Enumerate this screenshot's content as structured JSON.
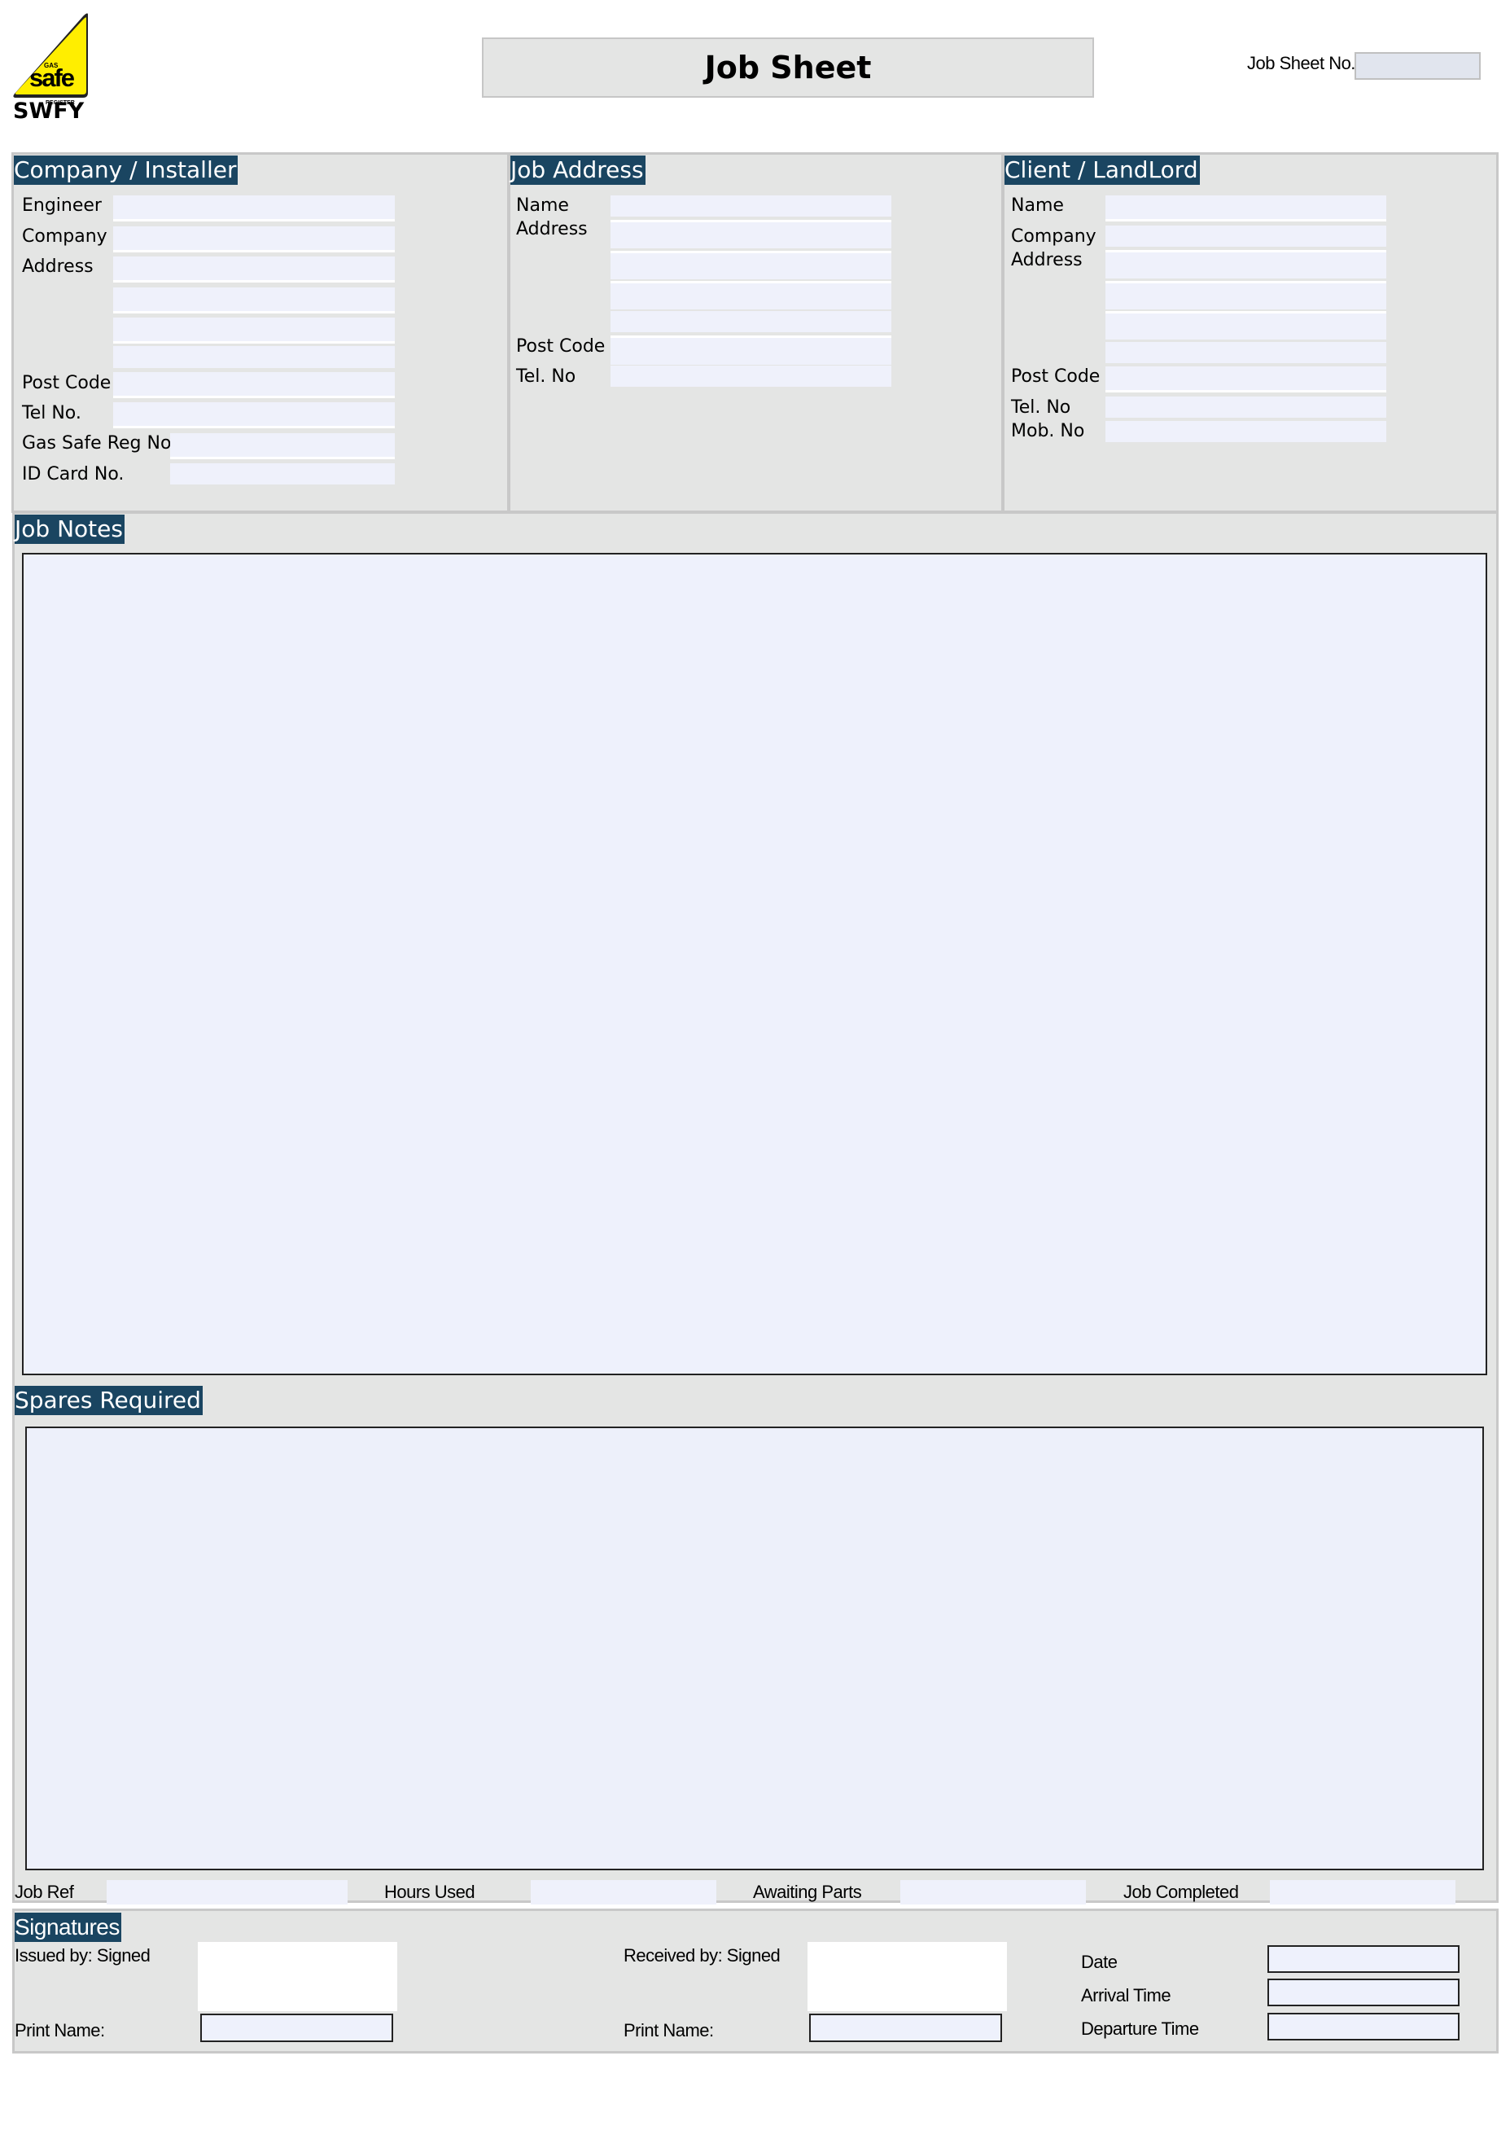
{
  "logo": {
    "brand_top": "GAS",
    "brand_main": "safe",
    "brand_bottom": "REGISTER",
    "company_code": "SWFY",
    "icon": "gas-safe-triangle-icon",
    "color": "#ffee00"
  },
  "header": {
    "title": "Job Sheet",
    "job_sheet_no_label": "Job Sheet No.",
    "job_sheet_no_value": ""
  },
  "colors": {
    "heading_bg": "#1a4561",
    "panel_bg": "#e4e5e4",
    "field_bg": "#eff1fb"
  },
  "company_installer": {
    "heading": "Company / Installer",
    "labels": {
      "engineer": "Engineer",
      "company": "Company",
      "address": "Address",
      "post_code": "Post Code",
      "tel_no": "Tel No.",
      "gas_safe_reg_no": "Gas Safe Reg No.",
      "id_card_no": "ID Card No."
    },
    "values": {
      "engineer": "",
      "company": "",
      "address_1": "",
      "address_2": "",
      "address_3": "",
      "address_4": "",
      "post_code": "",
      "tel_no": "",
      "gas_safe_reg_no": "",
      "id_card_no": ""
    }
  },
  "job_address": {
    "heading": "Job Address",
    "labels": {
      "name": "Name",
      "address": "Address",
      "post_code": "Post Code",
      "tel_no": "Tel. No"
    },
    "values": {
      "name": "",
      "address_1": "",
      "address_2": "",
      "address_3": "",
      "address_4": "",
      "post_code": "",
      "tel_no": ""
    }
  },
  "client_landlord": {
    "heading": "Client / LandLord",
    "labels": {
      "name": "Name",
      "company": "Company",
      "address": "Address",
      "post_code": "Post Code",
      "tel_no": "Tel. No",
      "mob_no": "Mob. No"
    },
    "values": {
      "name": "",
      "company": "",
      "address_1": "",
      "address_2": "",
      "address_3": "",
      "address_4": "",
      "post_code": "",
      "tel_no": "",
      "mob_no": ""
    }
  },
  "job_notes": {
    "heading": "Job Notes",
    "value": ""
  },
  "spares_required": {
    "heading": "Spares Required",
    "value": ""
  },
  "status_row": {
    "job_ref_label": "Job Ref",
    "hours_used_label": "Hours Used",
    "awaiting_parts_label": "Awaiting Parts",
    "job_completed_label": "Job Completed",
    "job_ref": "",
    "hours_used": "",
    "awaiting_parts": "",
    "job_completed": ""
  },
  "signatures": {
    "heading": "Signatures",
    "issued_by_label": "Issued by: Signed",
    "received_by_label": "Received by: Signed",
    "print_name_label": "Print Name:",
    "date_label": "Date",
    "arrival_time_label": "Arrival Time",
    "departure_time_label": "Departure Time",
    "issued_print_name": "",
    "received_print_name": "",
    "date": "",
    "arrival_time": "",
    "departure_time": ""
  }
}
